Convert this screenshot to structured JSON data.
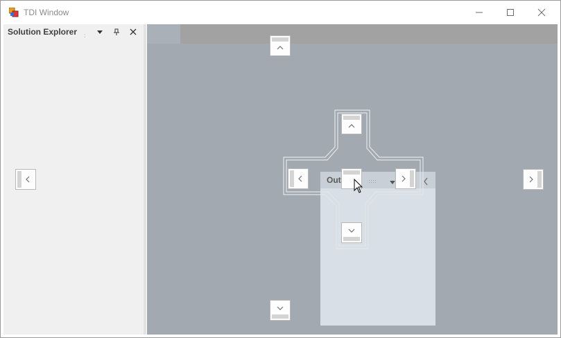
{
  "window": {
    "title": "TDI Window",
    "controls": [
      "minimize",
      "maximize",
      "close"
    ]
  },
  "solution_explorer": {
    "title": "Solution Explorer",
    "buttons": [
      "dropdown",
      "pin",
      "close"
    ]
  },
  "output_panel": {
    "title": "Out"
  },
  "dock_guides": {
    "outer": [
      "top",
      "left",
      "right",
      "bottom"
    ],
    "center_cross": [
      "top",
      "left",
      "center",
      "right",
      "bottom"
    ]
  },
  "colors": {
    "document_area": "#a3a9b1",
    "panel_bg": "#f0f0f0",
    "floating_panel": "#d9dfe6"
  }
}
